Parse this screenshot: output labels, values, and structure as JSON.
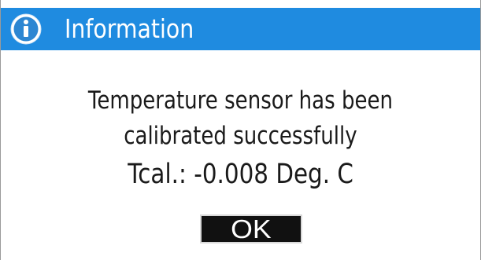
{
  "titlebar": {
    "title": "Information",
    "icon": "info-icon",
    "color": "#1f8be0"
  },
  "message": {
    "line1": "Temperature sensor has been",
    "line2": "calibrated successfully",
    "line3": "Tcal.: -0.008 Deg. C"
  },
  "buttons": {
    "ok_label": "OK"
  }
}
